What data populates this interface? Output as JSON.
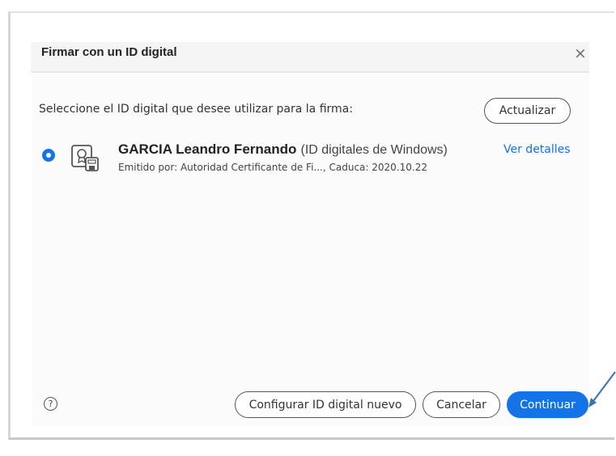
{
  "dialog": {
    "title": "Firmar con un ID digital",
    "close_icon": "close-icon"
  },
  "content": {
    "instruction": "Seleccione el ID digital que desee utilizar para la firma:",
    "refresh_label": "Actualizar"
  },
  "ids": [
    {
      "selected": true,
      "icon": "certificate-icon",
      "name": "GARCIA Leandro Fernando",
      "store": "(ID digitales de Windows)",
      "issued_by": "Emitido por: Autoridad Certificante de Fi..., Caduca: 2020.10.22",
      "details_label": "Ver detalles"
    }
  ],
  "footer": {
    "help_icon": "help-icon",
    "help_symbol": "?",
    "configure_label": "Configurar ID digital nuevo",
    "cancel_label": "Cancelar",
    "continue_label": "Continuar"
  },
  "colors": {
    "accent": "#1473e6",
    "annotation_arrow": "#3f6fb3"
  }
}
